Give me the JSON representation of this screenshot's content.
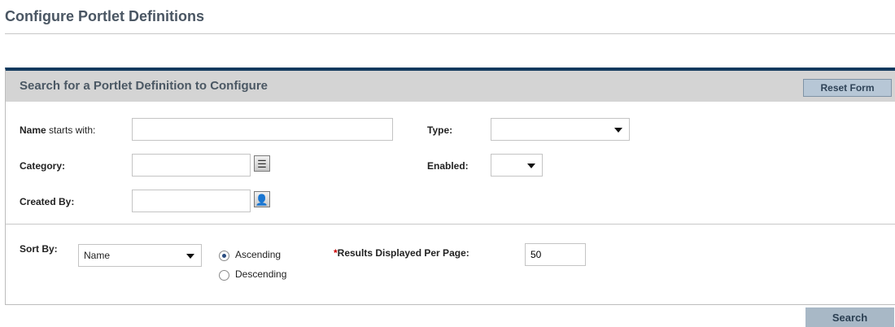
{
  "page": {
    "title": "Configure Portlet Definitions"
  },
  "panel": {
    "title": "Search for a Portlet Definition to Configure",
    "reset_label": "Reset Form"
  },
  "form": {
    "name_label_bold": "Name",
    "name_label_rest": " starts with:",
    "name_value": "",
    "type_label": "Type:",
    "type_value": "",
    "category_label": "Category:",
    "category_value": "",
    "enabled_label": "Enabled:",
    "enabled_value": "",
    "created_by_label": "Created By:",
    "created_by_value": ""
  },
  "sort": {
    "label": "Sort By:",
    "value": "Name",
    "ascending_label": "Ascending",
    "descending_label": "Descending",
    "selected": "ascending",
    "required_mark": "*",
    "results_label": "Results Displayed Per Page:",
    "results_value": "50"
  },
  "footer": {
    "search_label": "Search"
  },
  "icons": {
    "category": "list-picker-icon",
    "created_by": "user-picker-icon"
  }
}
